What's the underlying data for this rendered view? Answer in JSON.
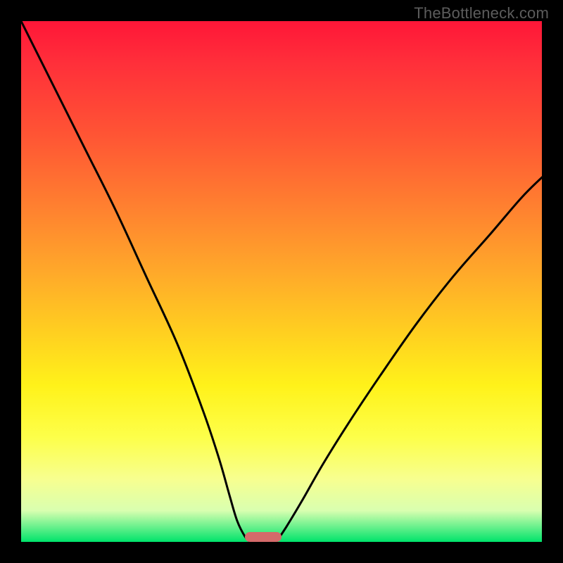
{
  "watermark": "TheBottleneck.com",
  "colors": {
    "page_bg": "#000000",
    "gradient_top": "#ff1638",
    "gradient_mid": "#fff21a",
    "gradient_bottom": "#00e36b",
    "curve_stroke": "#000000",
    "marker": "#d46a6a"
  },
  "chart_data": {
    "type": "line",
    "title": "",
    "xlabel": "",
    "ylabel": "",
    "x_range": [
      0,
      100
    ],
    "y_range": [
      0,
      100
    ],
    "notes": "Bottleneck-style chart: two black curves descend from opposite sides and meet near zero at the optimal point; background is a vertical heat gradient (red at top = bad, green at bottom = good). Axes carry no tick labels in the source image; values are normalized 0–100.",
    "series": [
      {
        "name": "left-curve",
        "x": [
          0,
          6,
          12,
          18,
          24,
          30,
          35,
          38,
          40,
          41.5,
          43,
          44
        ],
        "y": [
          100,
          88,
          76,
          64,
          51,
          38,
          25,
          16,
          9,
          4,
          1,
          0
        ]
      },
      {
        "name": "right-curve",
        "x": [
          49,
          51,
          54,
          58,
          63,
          69,
          76,
          83,
          90,
          96,
          100
        ],
        "y": [
          0,
          3,
          8,
          15,
          23,
          32,
          42,
          51,
          59,
          66,
          70
        ]
      }
    ],
    "optimal_marker": {
      "x_start": 43,
      "x_end": 50,
      "y": 0
    },
    "legend": null
  }
}
